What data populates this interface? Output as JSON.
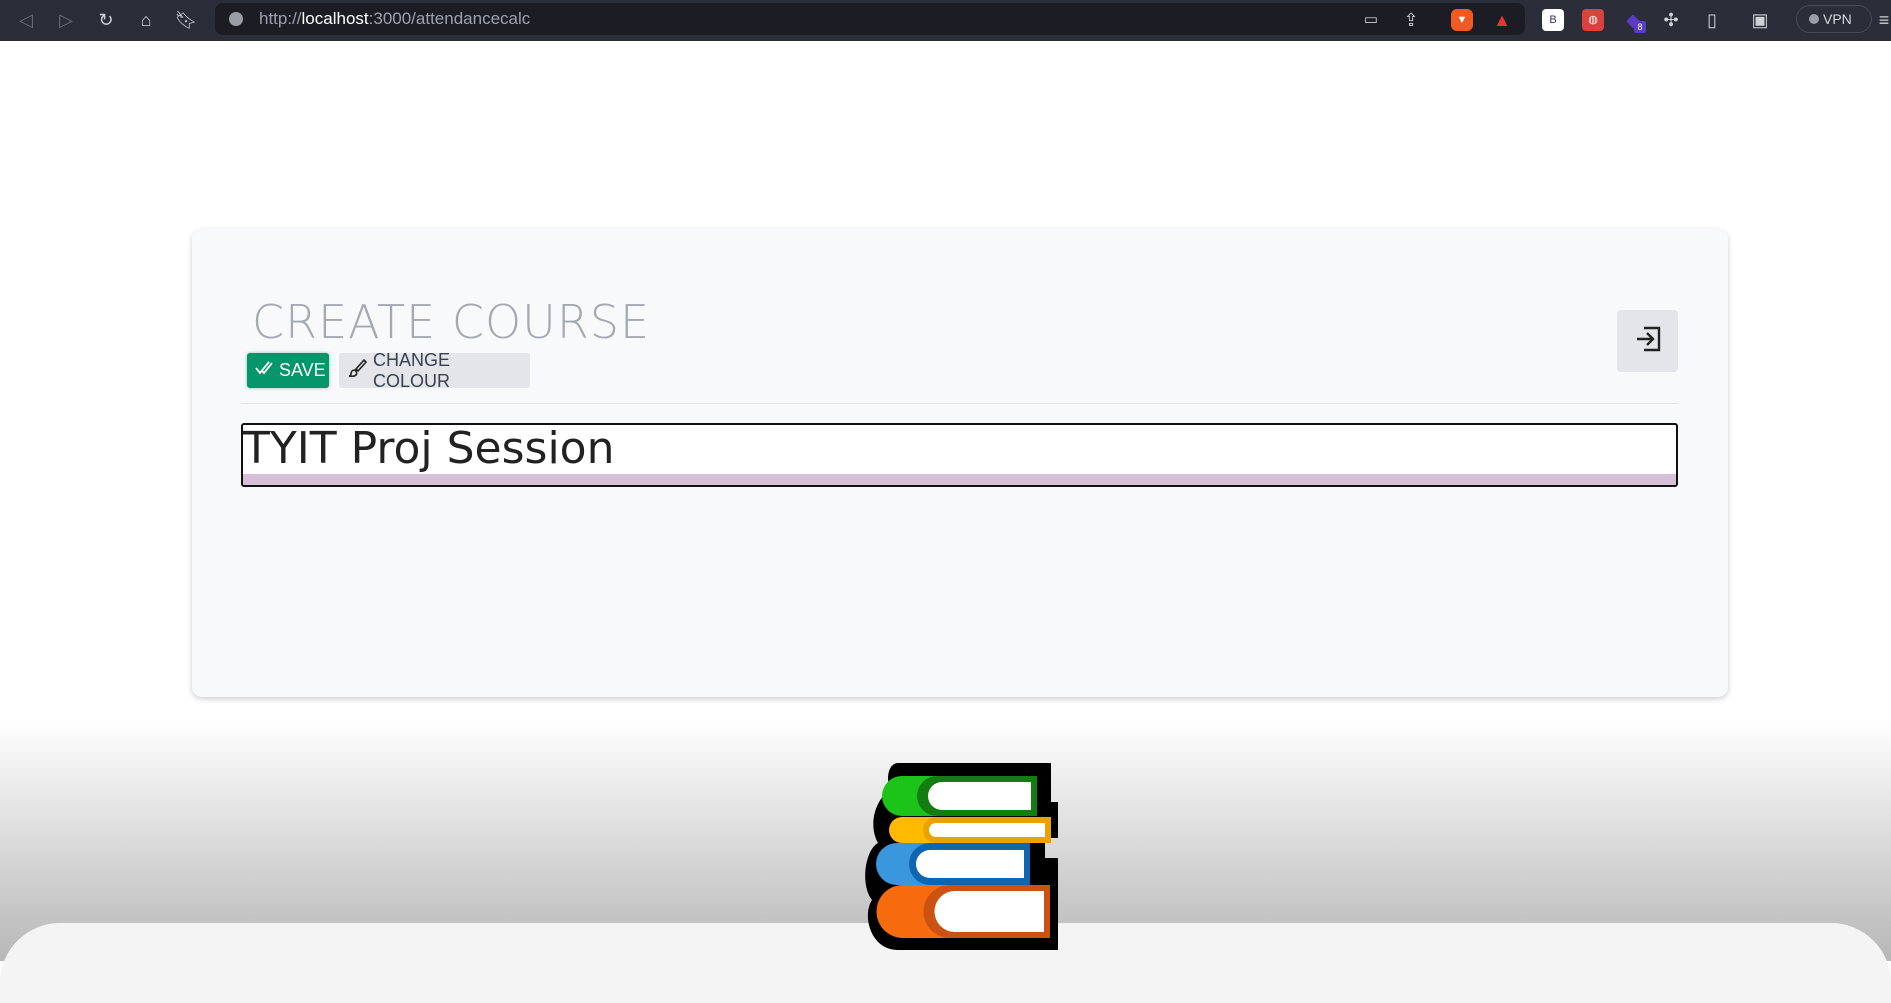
{
  "browser": {
    "url_prefix": "http://",
    "url_host": "localhost",
    "url_rest": ":3000/attendancecalc",
    "vpn_label": "VPN",
    "ext_badge": "8",
    "ext_b": "B"
  },
  "card": {
    "title": "CREATE COURSE",
    "save_label": "SAVE",
    "change_colour_label": "CHANGE COLOUR",
    "course_name_value": "TYIT Proj Session",
    "selected_colour": "#d8bfd8"
  }
}
